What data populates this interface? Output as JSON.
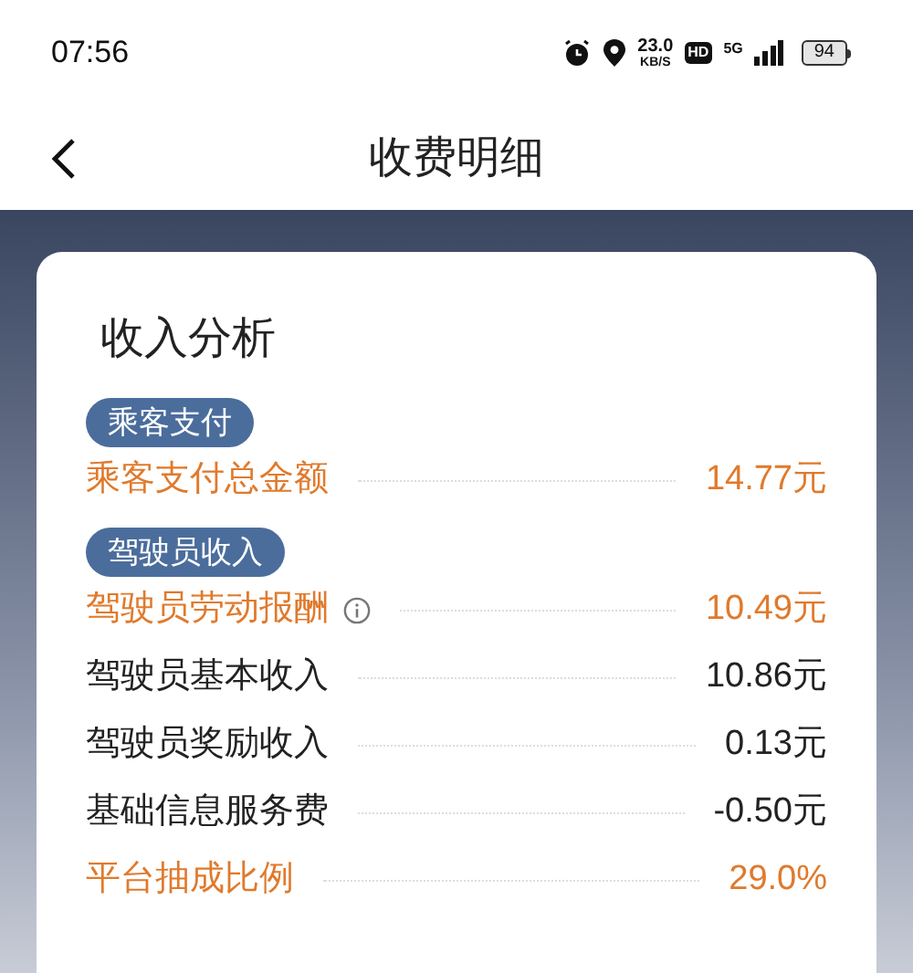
{
  "status_bar": {
    "time": "07:56",
    "net_speed": "23.0",
    "net_unit": "KB/S",
    "hd": "HD",
    "network": "5G",
    "battery": "94"
  },
  "header": {
    "title": "收费明细"
  },
  "card": {
    "title": "收入分析",
    "sections": [
      {
        "tag": "乘客支付",
        "rows": [
          {
            "label": "乘客支付总金额",
            "value": "14.77元",
            "highlighted": true,
            "info": false
          }
        ]
      },
      {
        "tag": "驾驶员收入",
        "rows": [
          {
            "label": "驾驶员劳动报酬",
            "value": "10.49元",
            "highlighted": true,
            "info": true
          },
          {
            "label": "驾驶员基本收入",
            "value": "10.86元",
            "highlighted": false,
            "info": false
          },
          {
            "label": "驾驶员奖励收入",
            "value": "0.13元",
            "highlighted": false,
            "info": false
          },
          {
            "label": "基础信息服务费",
            "value": "-0.50元",
            "highlighted": false,
            "info": false
          },
          {
            "label": "平台抽成比例",
            "value": "29.0%",
            "highlighted": true,
            "info": false
          }
        ]
      }
    ]
  }
}
